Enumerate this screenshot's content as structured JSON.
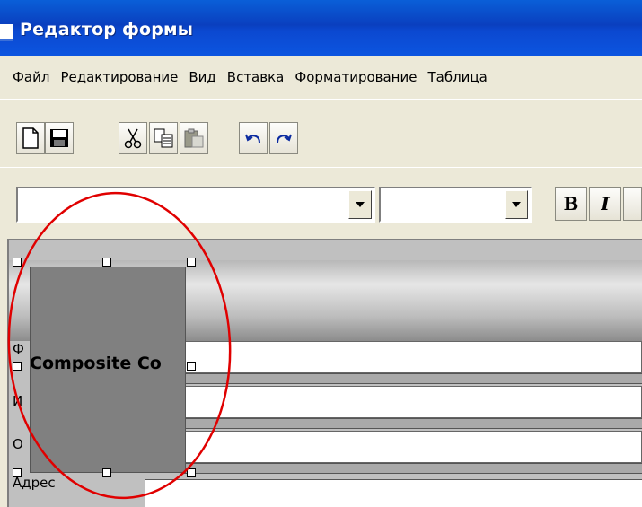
{
  "window": {
    "title": "Редактор формы"
  },
  "menu": [
    "Файл",
    "Редактирование",
    "Вид",
    "Вставка",
    "Форматирование",
    "Таблица"
  ],
  "toolbar": {
    "icons": [
      "new-document-icon",
      "save-icon",
      "cut-icon",
      "copy-icon",
      "paste-icon",
      "undo-icon",
      "redo-icon"
    ]
  },
  "format_toolbar": {
    "font_value": "",
    "size_value": "",
    "bold_label": "B",
    "italic_label": "I"
  },
  "form": {
    "composite_label": "Composite Co",
    "field_labels": [
      "Ф",
      "И",
      "О"
    ],
    "address_label": "Адрес"
  },
  "colors": {
    "titlebar": "#0a3fbf",
    "annotation_ellipse": "#e00000",
    "composite_fill": "#808080"
  }
}
